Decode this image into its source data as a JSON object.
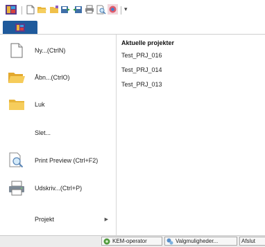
{
  "toolbar": {
    "icons": [
      "app-logo-icon",
      "new-document-icon",
      "open-folder-icon",
      "folder-icon",
      "save-export-icon",
      "save-import-icon",
      "print-icon",
      "print-preview-icon",
      "options-icon"
    ],
    "dropdown_glyph": "▾"
  },
  "menu": {
    "items": [
      {
        "label": "Ny...(CtrlN)",
        "icon": "new-document-icon"
      },
      {
        "label": "Åbn...(CtrlO)",
        "icon": "open-folder-icon"
      },
      {
        "label": "Luk",
        "icon": "folder-icon"
      },
      {
        "label": "Slet...",
        "icon": ""
      },
      {
        "label": "Print Preview (Ctrl+F2)",
        "icon": "print-preview-icon"
      },
      {
        "label": "Udskriv...(Ctrl+P)",
        "icon": "printer-icon"
      },
      {
        "label": "Projekt",
        "icon": "",
        "arrow": "▶"
      }
    ]
  },
  "recent": {
    "title": "Aktuelle projekter",
    "items": [
      "Test_PRJ_016",
      "Test_PRJ_014",
      "Test_PRJ_013"
    ]
  },
  "statusbar": {
    "buttons": [
      "KEM-operator",
      "Valgmuligheder...",
      "Afslut"
    ]
  },
  "colors": {
    "app_tab": "#1f5a9c",
    "folder": "#f0c04a",
    "statusbar": "#ececec"
  }
}
